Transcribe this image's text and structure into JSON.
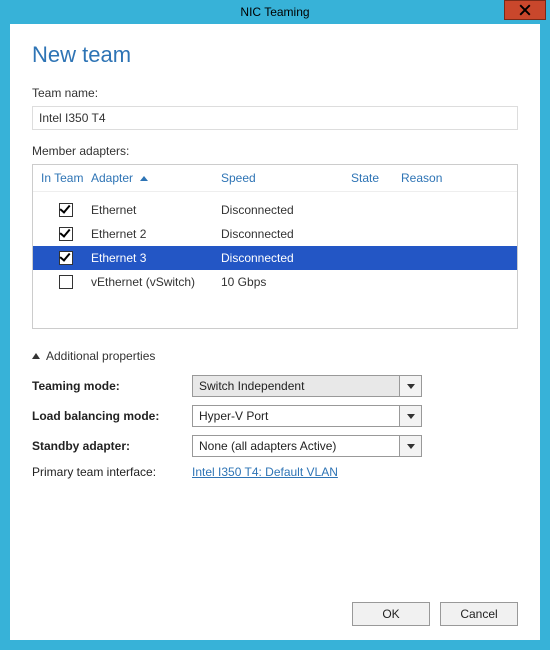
{
  "window": {
    "title": "NIC Teaming"
  },
  "page": {
    "heading": "New team"
  },
  "team_name": {
    "label": "Team name:",
    "value": "Intel I350 T4"
  },
  "members": {
    "label": "Member adapters:",
    "columns": {
      "team": "In Team",
      "adapter": "Adapter",
      "speed": "Speed",
      "state": "State",
      "reason": "Reason"
    },
    "rows": [
      {
        "in_team": true,
        "adapter": "Ethernet",
        "speed": "Disconnected",
        "state": "",
        "reason": "",
        "selected": false
      },
      {
        "in_team": true,
        "adapter": "Ethernet 2",
        "speed": "Disconnected",
        "state": "",
        "reason": "",
        "selected": false
      },
      {
        "in_team": true,
        "adapter": "Ethernet 3",
        "speed": "Disconnected",
        "state": "",
        "reason": "",
        "selected": true
      },
      {
        "in_team": false,
        "adapter": "vEthernet (vSwitch)",
        "speed": "10 Gbps",
        "state": "",
        "reason": "",
        "selected": false
      }
    ]
  },
  "additional": {
    "heading": "Additional properties",
    "teaming_mode": {
      "label": "Teaming mode:",
      "value": "Switch Independent"
    },
    "load_balancing": {
      "label": "Load balancing mode:",
      "value": "Hyper-V Port"
    },
    "standby": {
      "label": "Standby adapter:",
      "value": "None (all adapters Active)"
    },
    "primary_if": {
      "label": "Primary team interface:",
      "link": "Intel I350 T4: Default VLAN"
    }
  },
  "buttons": {
    "ok": "OK",
    "cancel": "Cancel"
  }
}
